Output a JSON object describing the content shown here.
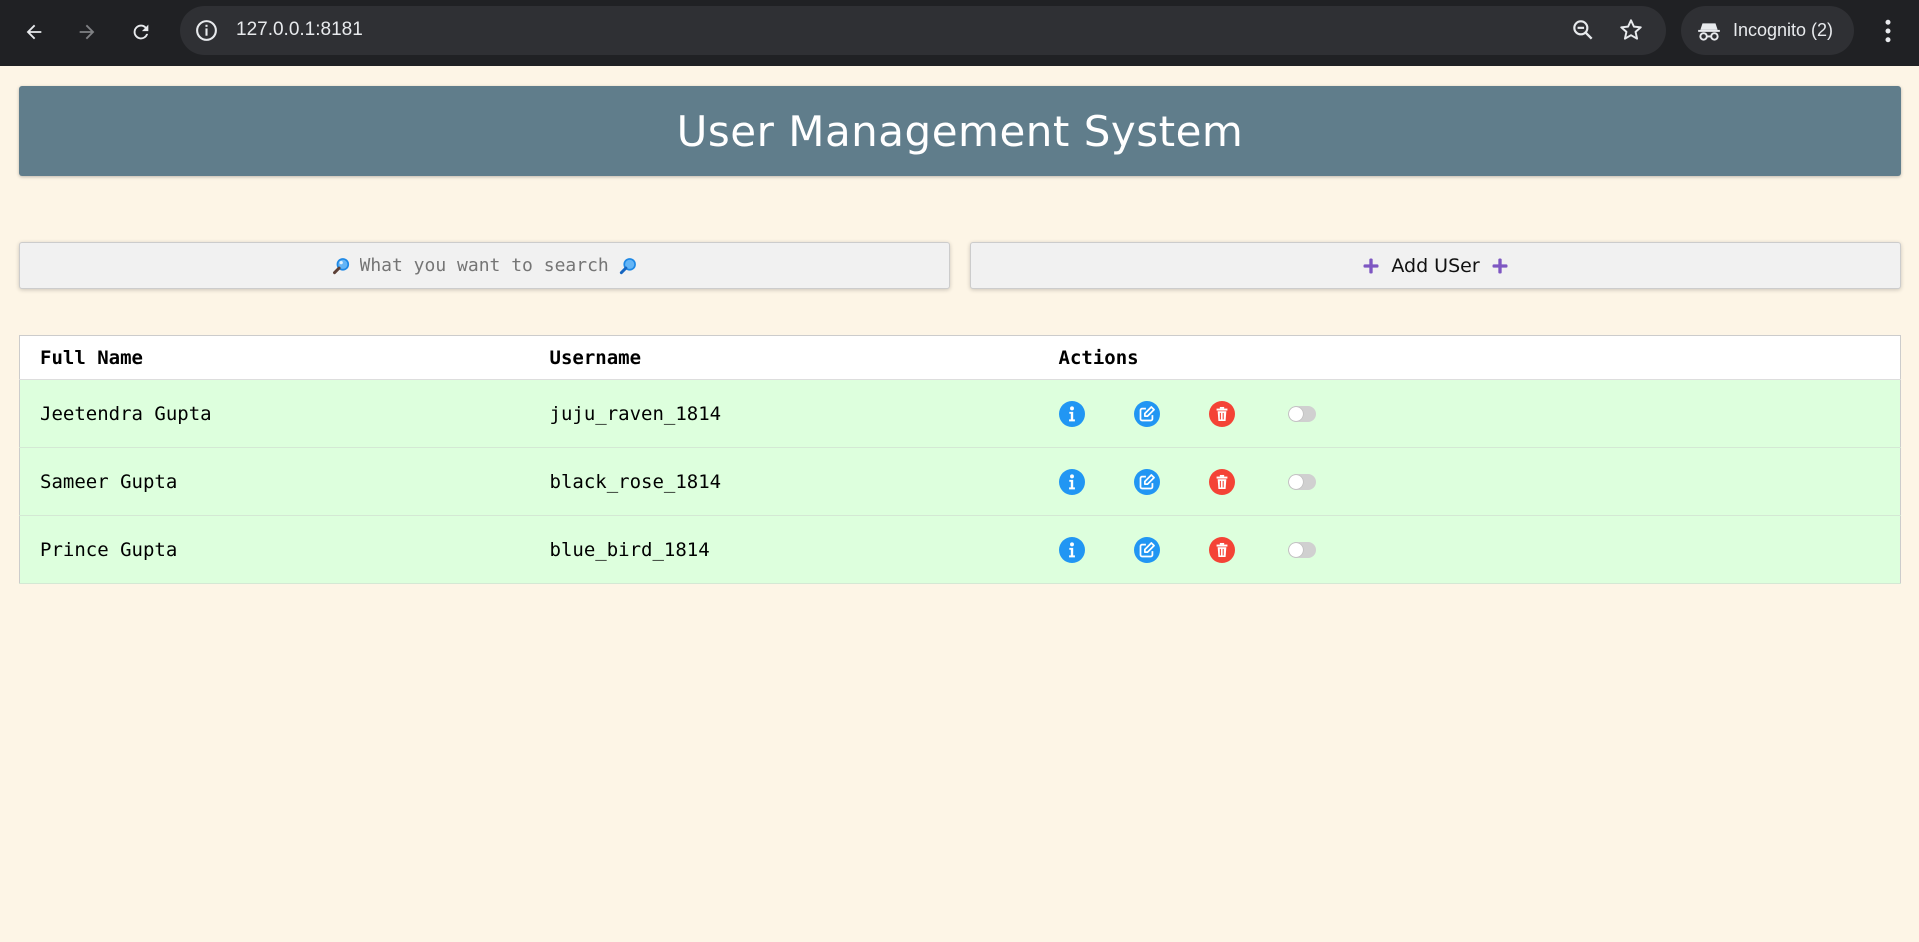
{
  "browser": {
    "url": "127.0.0.1:8181",
    "incognito_label": "Incognito (2)"
  },
  "page": {
    "title": "User Management System",
    "search": {
      "placeholder": "What you want to search..."
    },
    "add_button": {
      "label": "Add USer"
    }
  },
  "table": {
    "headers": [
      "Full Name",
      "Username",
      "Actions"
    ],
    "rows": [
      {
        "full_name": "Jeetendra Gupta",
        "username": "juju_raven_1814",
        "active": false
      },
      {
        "full_name": "Sameer Gupta",
        "username": "black_rose_1814",
        "active": false
      },
      {
        "full_name": "Prince Gupta",
        "username": "blue_bird_1814",
        "active": false
      }
    ]
  },
  "colors": {
    "header_bg": "#607d8b",
    "page_bg": "#fdf5e6",
    "row_bg": "#ddffdd",
    "info": "#2196f3",
    "edit": "#2196f3",
    "delete": "#f44336",
    "plus": "#7e57c2"
  },
  "icons": [
    "back-arrow-icon",
    "forward-arrow-icon",
    "reload-icon",
    "site-info-icon",
    "zoom-icon",
    "star-icon",
    "incognito-icon",
    "menu-icon",
    "search-icon",
    "magnifier-icon",
    "plus-icon",
    "info-icon",
    "edit-icon",
    "trash-icon"
  ]
}
